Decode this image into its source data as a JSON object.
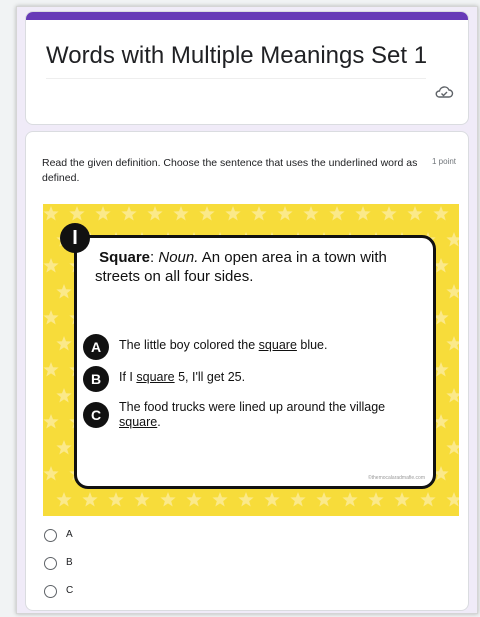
{
  "form": {
    "title": "Words with Multiple Meanings Set 1",
    "accent_color": "#673ab7",
    "cloud_icon": "cloud-saved-icon"
  },
  "question": {
    "text": "Read the given definition. Choose the sentence that uses the underlined word as defined.",
    "points": "1 point",
    "image": {
      "badge": "I",
      "word": "Square",
      "word_colon": ":",
      "part_of_speech": "Noun.",
      "definition": " An open area in a town with streets on all four sides.",
      "options": [
        {
          "letter": "A",
          "before": "The little boy colored the ",
          "underlined": "square",
          "after": " blue."
        },
        {
          "letter": "B",
          "before": "If I ",
          "underlined": "square",
          "after": " 5, I'll get 25."
        },
        {
          "letter": "C",
          "before": "The food trucks were lined up around the village ",
          "underlined": "square",
          "after": "."
        }
      ],
      "watermark": "©themocalaradmafie.com",
      "background_color": "#f7dc3a"
    },
    "choices": [
      "A",
      "B",
      "C"
    ]
  }
}
